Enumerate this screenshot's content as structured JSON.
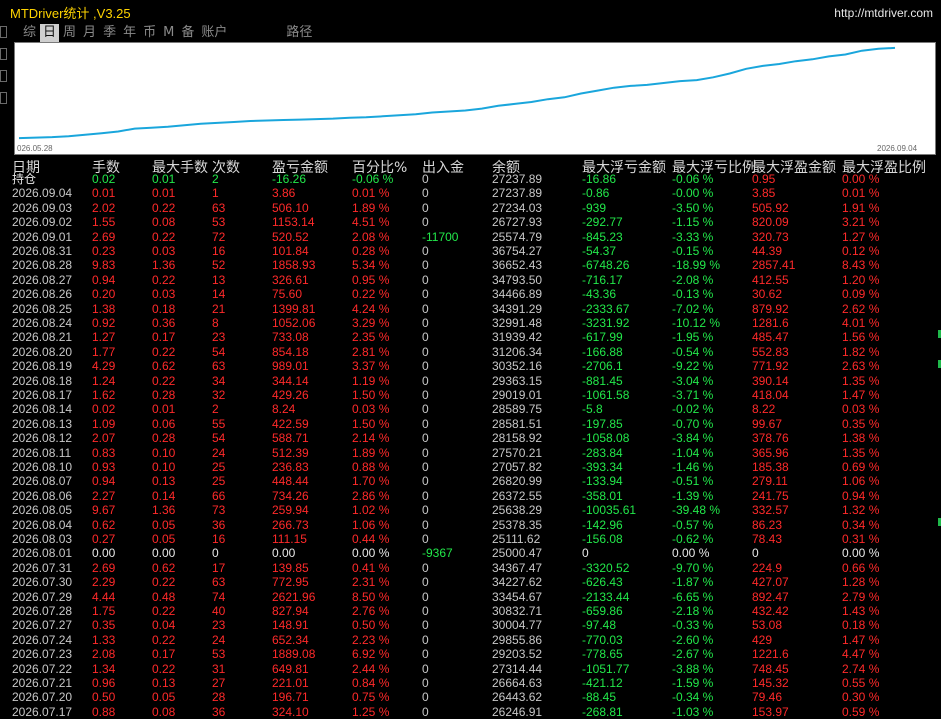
{
  "app": {
    "title": "MTDriver统计  ,V3.25",
    "url": "http://mtdriver.com"
  },
  "tabs": [
    {
      "label": "综",
      "active": false
    },
    {
      "label": "日",
      "active": true
    },
    {
      "label": "周",
      "active": false
    },
    {
      "label": "月",
      "active": false
    },
    {
      "label": "季",
      "active": false
    },
    {
      "label": "年",
      "active": false
    },
    {
      "label": "币",
      "active": false
    },
    {
      "label": "M",
      "active": false
    },
    {
      "label": "备",
      "active": false
    },
    {
      "label": "账户",
      "active": false
    },
    {
      "label": "路径",
      "active": false
    }
  ],
  "chart_data": {
    "type": "line",
    "x_start_label": "026.05.28",
    "x_end_label": "2026.09.04",
    "y_range": [
      0,
      1
    ],
    "values": [
      0.02,
      0.025,
      0.03,
      0.04,
      0.055,
      0.07,
      0.09,
      0.12,
      0.13,
      0.14,
      0.155,
      0.17,
      0.18,
      0.19,
      0.2,
      0.205,
      0.21,
      0.215,
      0.22,
      0.225,
      0.235,
      0.24,
      0.25,
      0.26,
      0.27,
      0.29,
      0.3,
      0.31,
      0.33,
      0.36,
      0.38,
      0.4,
      0.43,
      0.45,
      0.49,
      0.52,
      0.55,
      0.57,
      0.58,
      0.6,
      0.62,
      0.63,
      0.66,
      0.7,
      0.75,
      0.78,
      0.8,
      0.83,
      0.85,
      0.88,
      0.9,
      0.94,
      0.96,
      0.97
    ],
    "line_color": "#1aa6dc",
    "grid": false
  },
  "table": {
    "headers": {
      "date": "日期",
      "lots": "手数",
      "max_lots": "最大手数",
      "count": "次数",
      "pnl": "盈亏金额",
      "pct": "百分比%",
      "deposit": "出入金",
      "balance": "余额",
      "max_float_loss": "最大浮亏金额",
      "max_float_loss_pct": "最大浮亏比例",
      "max_float_profit": "最大浮盈金额",
      "max_float_profit_pct": "最大浮盈比例"
    },
    "rows": [
      [
        "持仓",
        "0.02",
        "0.01",
        "2",
        "-16.26",
        "-0.06 %",
        "0",
        "27237.89",
        "-16.86",
        "-0.06 %",
        "0.95",
        "0.00 %"
      ],
      [
        "2026.09.04",
        "0.01",
        "0.01",
        "1",
        "3.86",
        "0.01 %",
        "0",
        "27237.89",
        "-0.86",
        "-0.00 %",
        "3.85",
        "0.01 %"
      ],
      [
        "2026.09.03",
        "2.02",
        "0.22",
        "63",
        "506.10",
        "1.89 %",
        "0",
        "27234.03",
        "-939",
        "-3.50 %",
        "505.92",
        "1.91 %"
      ],
      [
        "2026.09.02",
        "1.55",
        "0.08",
        "53",
        "1153.14",
        "4.51 %",
        "0",
        "26727.93",
        "-292.77",
        "-1.15 %",
        "820.09",
        "3.21 %"
      ],
      [
        "2026.09.01",
        "2.69",
        "0.22",
        "72",
        "520.52",
        "2.08 %",
        "-11700",
        "25574.79",
        "-845.23",
        "-3.33 %",
        "320.73",
        "1.27 %"
      ],
      [
        "2026.08.31",
        "0.23",
        "0.03",
        "16",
        "101.84",
        "0.28 %",
        "0",
        "36754.27",
        "-54.37",
        "-0.15 %",
        "44.39",
        "0.12 %"
      ],
      [
        "2026.08.28",
        "9.83",
        "1.36",
        "52",
        "1858.93",
        "5.34 %",
        "0",
        "36652.43",
        "-6748.26",
        "-18.99 %",
        "2857.41",
        "8.43 %"
      ],
      [
        "2026.08.27",
        "0.94",
        "0.22",
        "13",
        "326.61",
        "0.95 %",
        "0",
        "34793.50",
        "-716.17",
        "-2.08 %",
        "412.55",
        "1.20 %"
      ],
      [
        "2026.08.26",
        "0.20",
        "0.03",
        "14",
        "75.60",
        "0.22 %",
        "0",
        "34466.89",
        "-43.36",
        "-0.13 %",
        "30.62",
        "0.09 %"
      ],
      [
        "2026.08.25",
        "1.38",
        "0.18",
        "21",
        "1399.81",
        "4.24 %",
        "0",
        "34391.29",
        "-2333.67",
        "-7.02 %",
        "879.92",
        "2.62 %"
      ],
      [
        "2026.08.24",
        "0.92",
        "0.36",
        "8",
        "1052.06",
        "3.29 %",
        "0",
        "32991.48",
        "-3231.92",
        "-10.12 %",
        "1281.6",
        "4.01 %"
      ],
      [
        "2026.08.21",
        "1.27",
        "0.17",
        "23",
        "733.08",
        "2.35 %",
        "0",
        "31939.42",
        "-617.99",
        "-1.95 %",
        "485.47",
        "1.56 %"
      ],
      [
        "2026.08.20",
        "1.77",
        "0.22",
        "54",
        "854.18",
        "2.81 %",
        "0",
        "31206.34",
        "-166.88",
        "-0.54 %",
        "552.83",
        "1.82 %"
      ],
      [
        "2026.08.19",
        "4.29",
        "0.62",
        "63",
        "989.01",
        "3.37 %",
        "0",
        "30352.16",
        "-2706.1",
        "-9.22 %",
        "771.92",
        "2.63 %"
      ],
      [
        "2026.08.18",
        "1.24",
        "0.22",
        "34",
        "344.14",
        "1.19 %",
        "0",
        "29363.15",
        "-881.45",
        "-3.04 %",
        "390.14",
        "1.35 %"
      ],
      [
        "2026.08.17",
        "1.62",
        "0.28",
        "32",
        "429.26",
        "1.50 %",
        "0",
        "29019.01",
        "-1061.58",
        "-3.71 %",
        "418.04",
        "1.47 %"
      ],
      [
        "2026.08.14",
        "0.02",
        "0.01",
        "2",
        "8.24",
        "0.03 %",
        "0",
        "28589.75",
        "-5.8",
        "-0.02 %",
        "8.22",
        "0.03 %"
      ],
      [
        "2026.08.13",
        "1.09",
        "0.06",
        "55",
        "422.59",
        "1.50 %",
        "0",
        "28581.51",
        "-197.85",
        "-0.70 %",
        "99.67",
        "0.35 %"
      ],
      [
        "2026.08.12",
        "2.07",
        "0.28",
        "54",
        "588.71",
        "2.14 %",
        "0",
        "28158.92",
        "-1058.08",
        "-3.84 %",
        "378.76",
        "1.38 %"
      ],
      [
        "2026.08.11",
        "0.83",
        "0.10",
        "24",
        "512.39",
        "1.89 %",
        "0",
        "27570.21",
        "-283.84",
        "-1.04 %",
        "365.96",
        "1.35 %"
      ],
      [
        "2026.08.10",
        "0.93",
        "0.10",
        "25",
        "236.83",
        "0.88 %",
        "0",
        "27057.82",
        "-393.34",
        "-1.46 %",
        "185.38",
        "0.69 %"
      ],
      [
        "2026.08.07",
        "0.94",
        "0.13",
        "25",
        "448.44",
        "1.70 %",
        "0",
        "26820.99",
        "-133.94",
        "-0.51 %",
        "279.11",
        "1.06 %"
      ],
      [
        "2026.08.06",
        "2.27",
        "0.14",
        "66",
        "734.26",
        "2.86 %",
        "0",
        "26372.55",
        "-358.01",
        "-1.39 %",
        "241.75",
        "0.94 %"
      ],
      [
        "2026.08.05",
        "9.67",
        "1.36",
        "73",
        "259.94",
        "1.02 %",
        "0",
        "25638.29",
        "-10035.61",
        "-39.48 %",
        "332.57",
        "1.32 %"
      ],
      [
        "2026.08.04",
        "0.62",
        "0.05",
        "36",
        "266.73",
        "1.06 %",
        "0",
        "25378.35",
        "-142.96",
        "-0.57 %",
        "86.23",
        "0.34 %"
      ],
      [
        "2026.08.03",
        "0.27",
        "0.05",
        "16",
        "111.15",
        "0.44 %",
        "0",
        "25111.62",
        "-156.08",
        "-0.62 %",
        "78.43",
        "0.31 %"
      ],
      [
        "2026.08.01",
        "0.00",
        "0.00",
        "0",
        "0.00",
        "0.00 %",
        "-9367",
        "25000.47",
        "0",
        "0.00 %",
        "0",
        "0.00 %"
      ],
      [
        "2026.07.31",
        "2.69",
        "0.62",
        "17",
        "139.85",
        "0.41 %",
        "0",
        "34367.47",
        "-3320.52",
        "-9.70 %",
        "224.9",
        "0.66 %"
      ],
      [
        "2026.07.30",
        "2.29",
        "0.22",
        "63",
        "772.95",
        "2.31 %",
        "0",
        "34227.62",
        "-626.43",
        "-1.87 %",
        "427.07",
        "1.28 %"
      ],
      [
        "2026.07.29",
        "4.44",
        "0.48",
        "74",
        "2621.96",
        "8.50 %",
        "0",
        "33454.67",
        "-2133.44",
        "-6.65 %",
        "892.47",
        "2.79 %"
      ],
      [
        "2026.07.28",
        "1.75",
        "0.22",
        "40",
        "827.94",
        "2.76 %",
        "0",
        "30832.71",
        "-659.86",
        "-2.18 %",
        "432.42",
        "1.43 %"
      ],
      [
        "2026.07.27",
        "0.35",
        "0.04",
        "23",
        "148.91",
        "0.50 %",
        "0",
        "30004.77",
        "-97.48",
        "-0.33 %",
        "53.08",
        "0.18 %"
      ],
      [
        "2026.07.24",
        "1.33",
        "0.22",
        "24",
        "652.34",
        "2.23 %",
        "0",
        "29855.86",
        "-770.03",
        "-2.60 %",
        "429",
        "1.47 %"
      ],
      [
        "2026.07.23",
        "2.08",
        "0.17",
        "53",
        "1889.08",
        "6.92 %",
        "0",
        "29203.52",
        "-778.65",
        "-2.67 %",
        "1221.6",
        "4.47 %"
      ],
      [
        "2026.07.22",
        "1.34",
        "0.22",
        "31",
        "649.81",
        "2.44 %",
        "0",
        "27314.44",
        "-1051.77",
        "-3.88 %",
        "748.45",
        "2.74 %"
      ],
      [
        "2026.07.21",
        "0.96",
        "0.13",
        "27",
        "221.01",
        "0.84 %",
        "0",
        "26664.63",
        "-421.12",
        "-1.59 %",
        "145.32",
        "0.55 %"
      ],
      [
        "2026.07.20",
        "0.50",
        "0.05",
        "28",
        "196.71",
        "0.75 %",
        "0",
        "26443.62",
        "-88.45",
        "-0.34 %",
        "79.46",
        "0.30 %"
      ],
      [
        "2026.07.17",
        "0.88",
        "0.08",
        "36",
        "324.10",
        "1.25 %",
        "0",
        "26246.91",
        "-268.81",
        "-1.03 %",
        "153.97",
        "0.59 %"
      ]
    ]
  }
}
